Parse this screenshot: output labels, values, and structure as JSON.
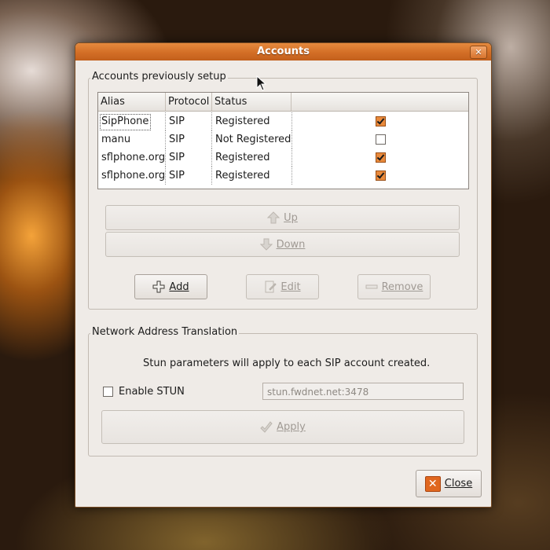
{
  "dialog": {
    "title": "Accounts"
  },
  "accounts_frame": {
    "legend": "Accounts previously setup",
    "columns": [
      "Alias",
      "Protocol",
      "Status",
      ""
    ],
    "rows": [
      {
        "alias": "SipPhone",
        "protocol": "SIP",
        "status": "Registered",
        "enabled": true
      },
      {
        "alias": "manu",
        "protocol": "SIP",
        "status": "Not Registered",
        "enabled": false
      },
      {
        "alias": "sflphone.org",
        "protocol": "SIP",
        "status": "Registered",
        "enabled": true
      },
      {
        "alias": "sflphone.org",
        "protocol": "SIP",
        "status": "Registered",
        "enabled": true
      }
    ],
    "up_label": "Up",
    "down_label": "Down",
    "add_label": "Add",
    "edit_label": "Edit",
    "remove_label": "Remove"
  },
  "nat_frame": {
    "legend": "Network Address Translation",
    "info": "Stun parameters will apply to each SIP account created.",
    "enable_stun_label": "Enable STUN",
    "enable_stun_checked": false,
    "stun_server": "stun.fwdnet.net:3478",
    "apply_label": "Apply"
  },
  "close_label": "Close",
  "colors": {
    "titlebar": "#d36e26",
    "check": "#e98a3c",
    "close_icon": "#e0671f"
  }
}
